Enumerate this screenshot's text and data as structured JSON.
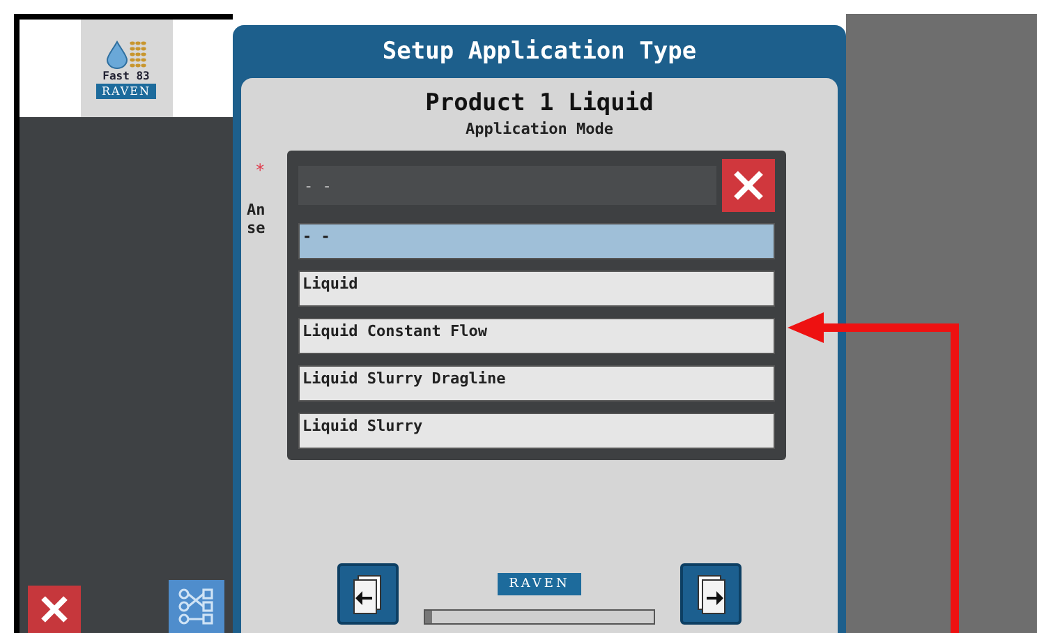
{
  "logo": {
    "caption": "Fast 83",
    "brand": "RAVEN"
  },
  "dialog": {
    "title": "Setup Application Type",
    "heading": "Product 1 Liquid",
    "subheading": "Application Mode",
    "required_mark": "*",
    "message_lines": [
      "An",
      "se"
    ],
    "dropdown": {
      "value": "- -",
      "options": [
        {
          "label": "- -",
          "selected": true
        },
        {
          "label": "Liquid",
          "selected": false
        },
        {
          "label": "Liquid Constant Flow",
          "selected": false
        },
        {
          "label": "Liquid Slurry Dragline",
          "selected": false
        },
        {
          "label": "Liquid Slurry",
          "selected": false
        }
      ]
    },
    "footer": {
      "brand": "RAVEN",
      "progress": {
        "level": 0.03
      }
    }
  }
}
